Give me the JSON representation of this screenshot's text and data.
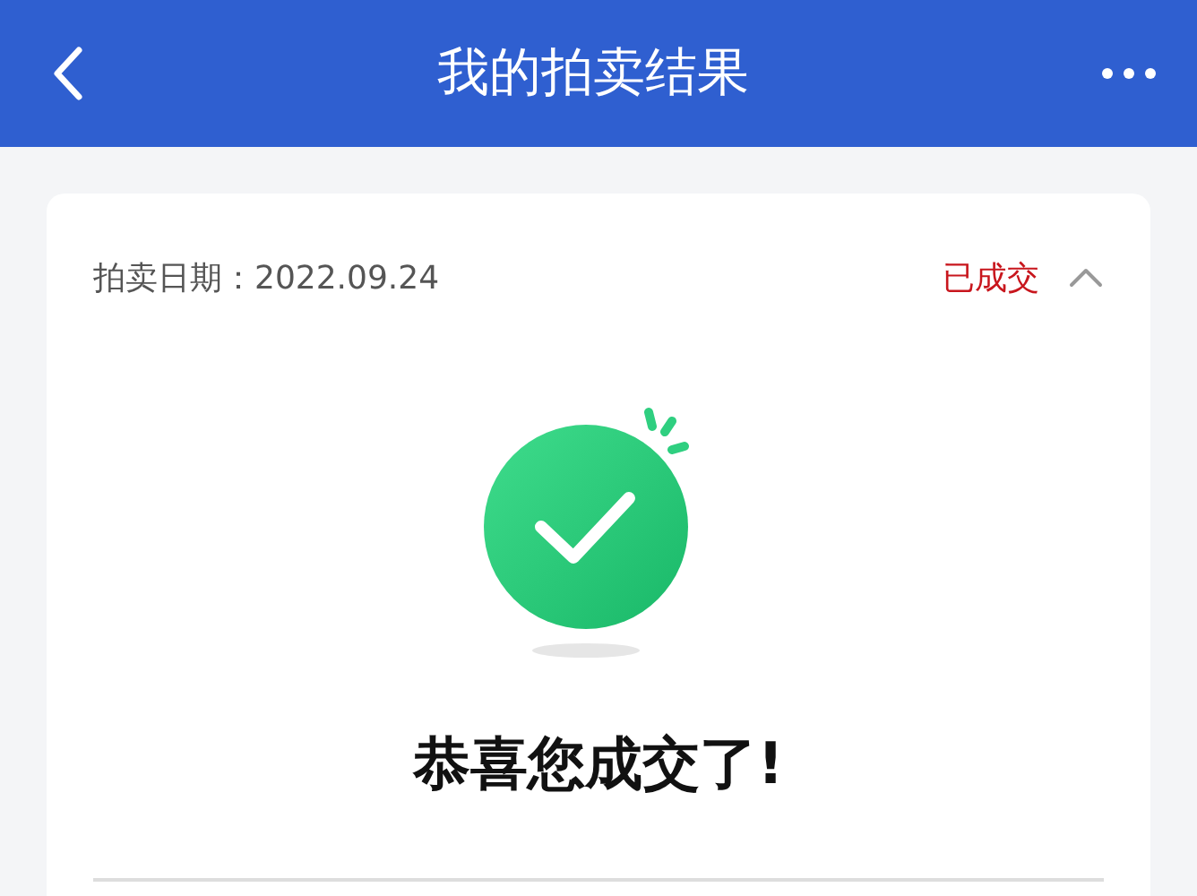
{
  "header": {
    "title": "我的拍卖结果"
  },
  "auction": {
    "date_label": "拍卖日期：2022.09.24",
    "status": "已成交",
    "expanded": true,
    "message": "恭喜您成交了!"
  }
}
